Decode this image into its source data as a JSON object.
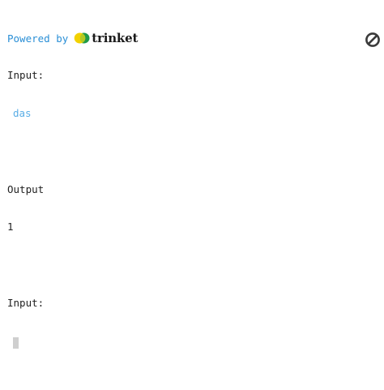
{
  "header": {
    "powered_by": "Powered by",
    "logo_text": "trinket"
  },
  "console": {
    "input_label_1": "Input:",
    "input_echo_1": "das",
    "output_label": "Output",
    "output_value": "1",
    "input_label_2": "Input:"
  },
  "icons": {
    "clear": "no-entry-icon",
    "logo": "trinket-logo-icon"
  },
  "colors": {
    "link_blue": "#2a8fd6",
    "echo_blue": "#5aaee6",
    "logo_green": "#1f9a4a",
    "logo_yellow": "#f2d100"
  }
}
